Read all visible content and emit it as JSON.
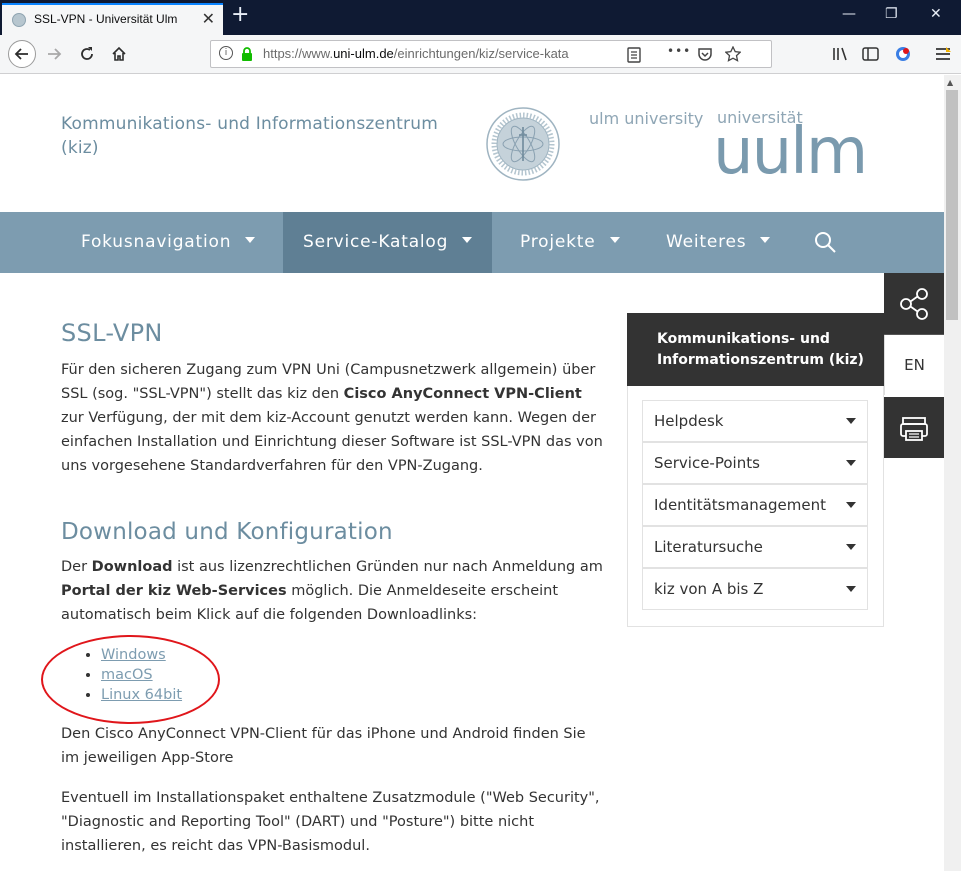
{
  "browser": {
    "tab_title": "SSL-VPN - Universität Ulm",
    "tab_close": "✕",
    "new_tab": "+",
    "win_min": "—",
    "win_max": "❐",
    "win_close": "✕",
    "url_prefix": "https://www.",
    "url_domain": "uni-ulm.de",
    "url_path": "/einrichtungen/kiz/service-kata",
    "more_menu": "•••"
  },
  "header": {
    "kiz_title": "Kommunikations- und Informationszentrum (kiz)",
    "english_name": "ulm university",
    "german_name": "universität",
    "wordmark": "uulm"
  },
  "mainnav": {
    "items": [
      {
        "label": "Fokusnavigation"
      },
      {
        "label": "Service-Katalog"
      },
      {
        "label": "Projekte"
      },
      {
        "label": "Weiteres"
      }
    ]
  },
  "content": {
    "title": "SSL-VPN",
    "intro_1": "Für den sicheren Zugang zum VPN Uni (Campusnetzwerk allgemein) über SSL (sog. \"SSL-VPN\") stellt das kiz den ",
    "intro_bold": "Cisco AnyConnect VPN-Client",
    "intro_2": " zur Verfügung, der mit dem kiz-Account genutzt werden kann. Wegen der einfachen Installation und Einrichtung dieser Software ist SSL-VPN das von uns vorgesehene Standardverfahren für den VPN-Zugang.",
    "download_heading": "Download und Konfiguration",
    "dl_1": "Der ",
    "dl_bold1": "Download",
    "dl_2": " ist aus lizenzrechtlichen Gründen nur nach Anmeldung am ",
    "dl_bold2": "Portal der kiz Web-Services",
    "dl_3": " möglich. Die Anmeldeseite erscheint automatisch beim Klick auf die folgenden Downloadlinks:",
    "links": [
      "Windows",
      "macOS",
      "Linux 64bit"
    ],
    "mobile_text": "Den Cisco AnyConnect VPN-Client für das iPhone und Android finden Sie im jeweiligen App-Store",
    "modules_text": "Eventuell im Installationspaket enthaltene Zusatzmodule (\"Web Security\", \"Diagnostic and Reporting Tool\" (DART) und \"Posture\") bitte nicht installieren, es reicht das VPN-Basismodul."
  },
  "sidebar": {
    "heading": "Kommunikations- und Informationszentrum (kiz)",
    "items": [
      "Helpdesk",
      "Service-Points",
      "Identitätsmanagement",
      "Literatursuche",
      "kiz von A bis Z"
    ]
  },
  "tools": {
    "language": "EN"
  },
  "colors": {
    "accent": "#7d9cb0",
    "accent_dark": "#5f7f94",
    "heading": "#6c8da0",
    "annotation": "#e0161b"
  }
}
